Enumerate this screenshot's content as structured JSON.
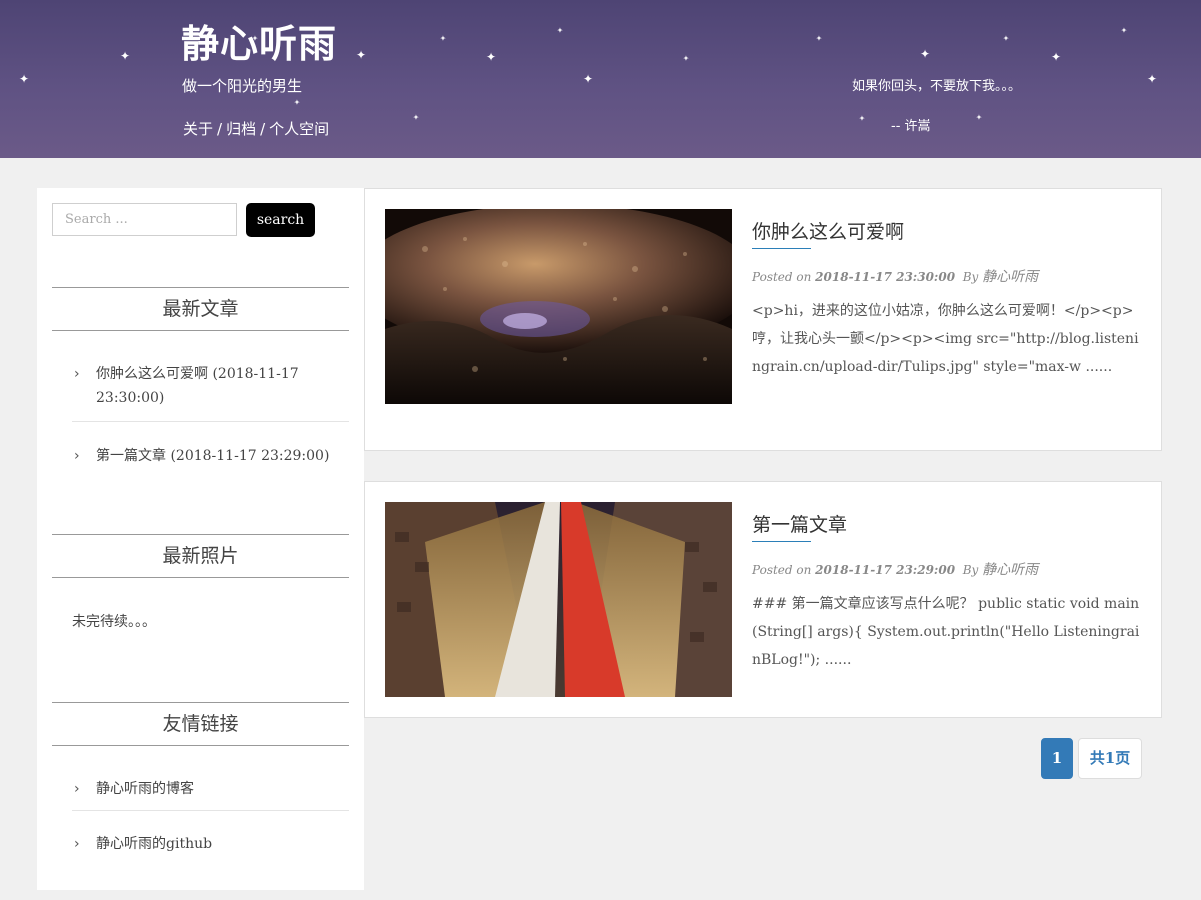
{
  "header": {
    "site_title": "静心听雨",
    "subtitle": "做一个阳光的男生",
    "nav": [
      {
        "label": "关于"
      },
      {
        "label": "归档"
      },
      {
        "label": "个人空间"
      }
    ],
    "nav_separator": "/",
    "quote": "如果你回头，不要放下我。。。",
    "quote_author": "-- 许嵩",
    "star_glyph": "✦"
  },
  "sidebar": {
    "search": {
      "placeholder": "Search ...",
      "button_label": "search"
    },
    "recent_posts": {
      "title": "最新文章",
      "items": [
        {
          "label": "你肿么这么可爱啊 (2018-11-17 23:30:00)"
        },
        {
          "label": "第一篇文章 (2018-11-17 23:29:00)"
        }
      ]
    },
    "recent_photos": {
      "title": "最新照片",
      "text": "未完待续。。。"
    },
    "friend_links": {
      "title": "友情链接",
      "items": [
        {
          "label": "静心听雨的博客"
        },
        {
          "label": "静心听雨的github"
        }
      ]
    },
    "chevron_glyph": "›"
  },
  "posts": [
    {
      "title": "你肿么这么可爱啊",
      "meta_prefix": "Posted on",
      "date": "2018-11-17 23:30:00",
      "by": "By",
      "author": "静心听雨",
      "excerpt": "<p>hi，进来的这位小姑凉，你肿么这么可爱啊！</p><p>哼，让我心头一颤</p><p><img src=\"http://blog.listeningrain.cn/upload-dir/Tulips.jpg\" style=\"max-w ......",
      "thumb": "cave"
    },
    {
      "title": "第一篇文章",
      "meta_prefix": "Posted on",
      "date": "2018-11-17 23:29:00",
      "by": "By",
      "author": "静心听雨",
      "excerpt": "### 第一篇文章应该写点什么呢？ public static void main(String[] args){ System.out.println(\"Hello ListeningrainBLog!\"); ......",
      "thumb": "city-street"
    }
  ],
  "pagination": {
    "current": "1",
    "total_label": "共1页"
  },
  "colors": {
    "header_top": "#4e4474",
    "header_bottom": "#6b5a88",
    "link_blue": "#337ab7",
    "title_underline": "#2b7fb8",
    "search_button": "#000000"
  }
}
